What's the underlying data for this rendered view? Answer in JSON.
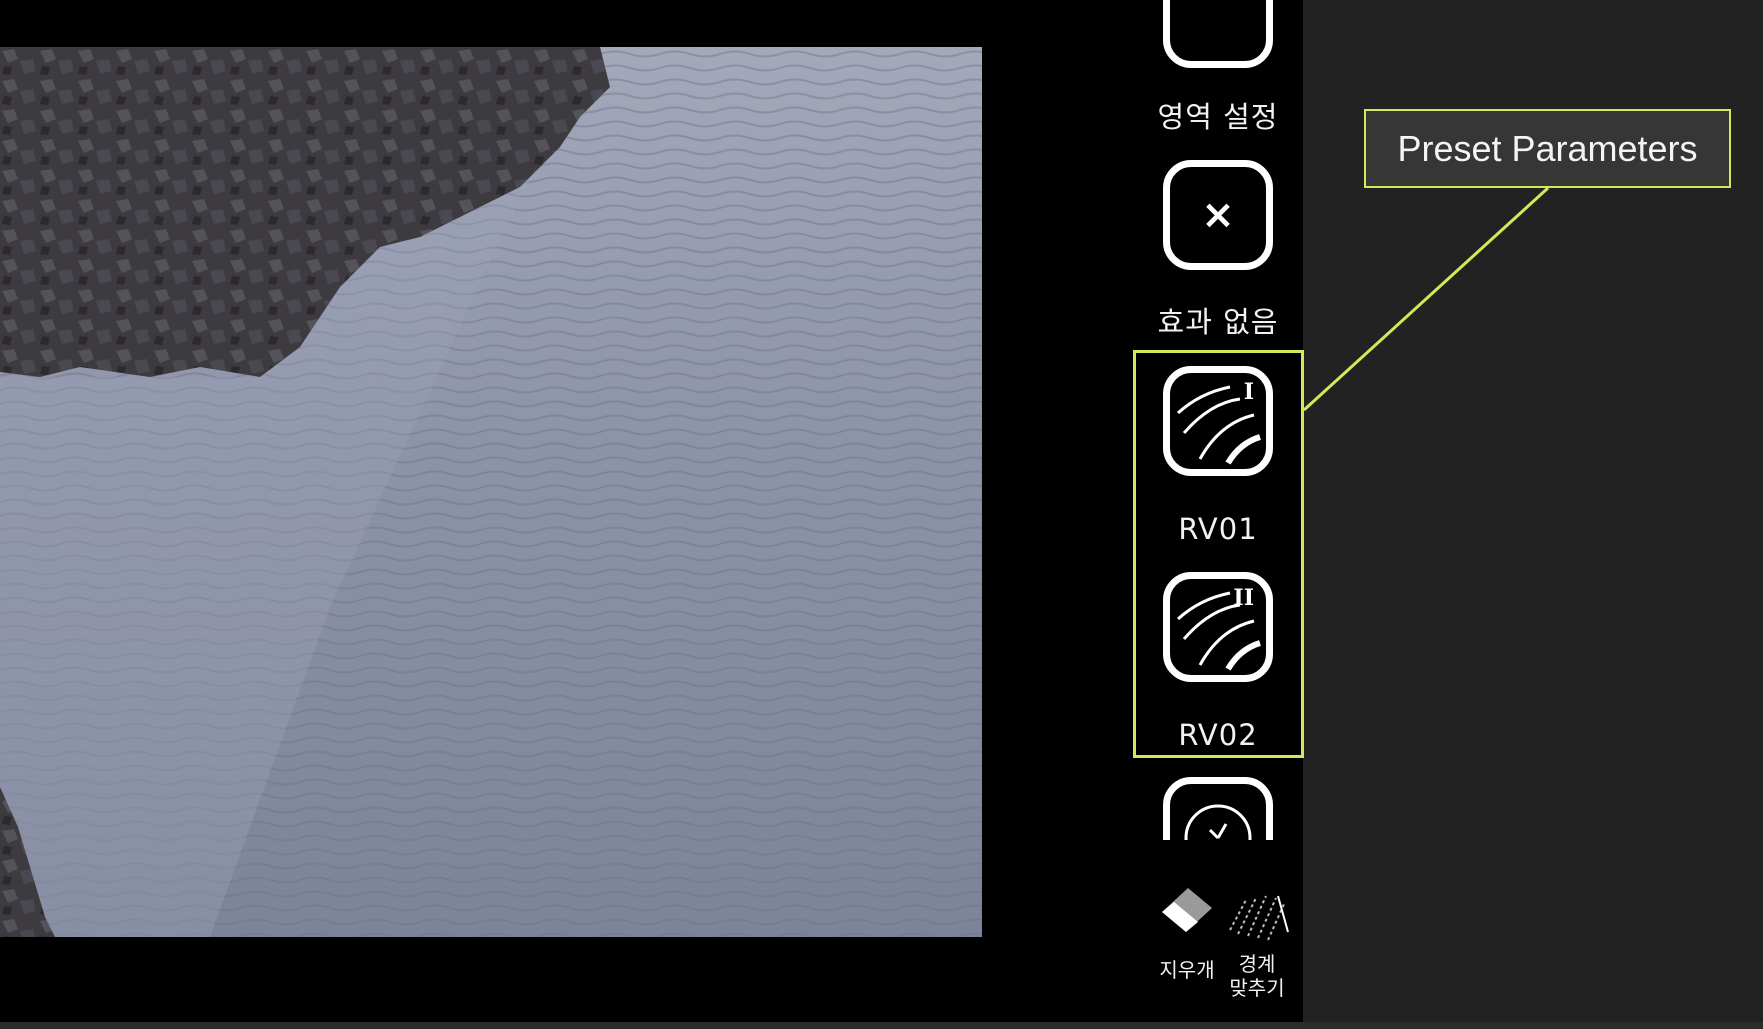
{
  "panel": {
    "region_label": "영역 설정",
    "no_effect_label": "효과 없음",
    "presets": [
      {
        "label": "RV01",
        "numeral": "I"
      },
      {
        "label": "RV02",
        "numeral": "II"
      }
    ],
    "no_effect_symbol": "×",
    "eraser_label": "지우개",
    "edge_fit_label_line1": "경계",
    "edge_fit_label_line2": "맞추기"
  },
  "annotation": {
    "callout_text": "Preset Parameters",
    "color": "#d6e85a"
  },
  "colors": {
    "app_background": "#000000",
    "outer_background": "#222222",
    "water": "#8c92a6",
    "rock": "#3a383c"
  },
  "icons": [
    "close-icon",
    "river-preset-icon",
    "clock-icon",
    "eraser-icon",
    "edge-fit-icon"
  ]
}
